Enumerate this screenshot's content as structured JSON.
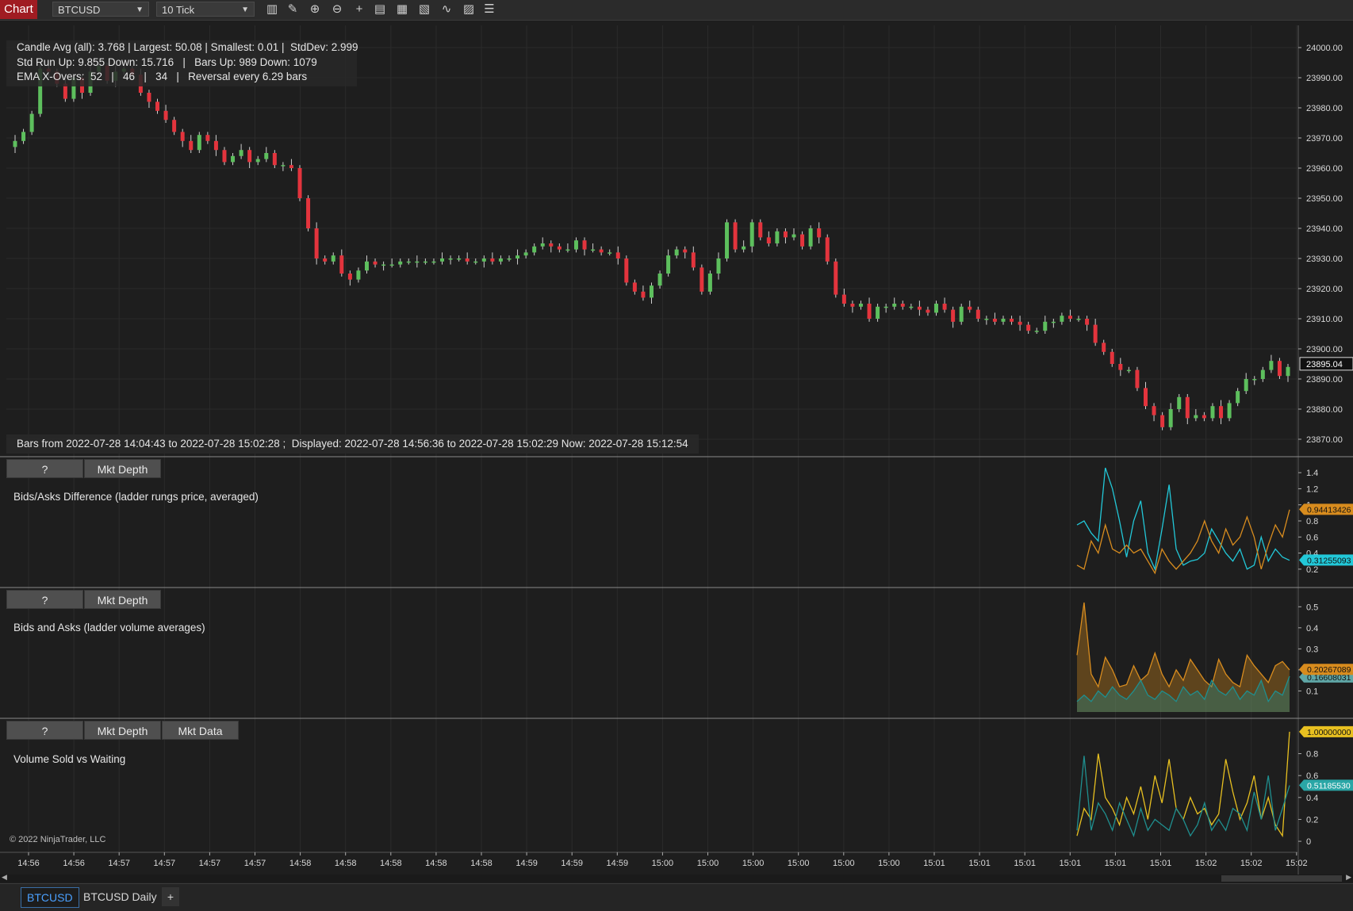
{
  "toolbar": {
    "chart_label": "Chart",
    "instrument": "BTCUSD",
    "interval": "10 Tick",
    "icons": [
      "bar-type-icon",
      "drawing-pencil-icon",
      "zoom-in-icon",
      "zoom-out-icon",
      "crosshair-icon",
      "data-box-icon",
      "properties-icon",
      "strategies-icon",
      "indicators-icon",
      "templates-icon",
      "object-list-icon"
    ]
  },
  "stats": {
    "line1": "Candle Avg (all): 3.768 | Largest: 50.08 | Smallest: 0.01 |  StdDev: 2.999",
    "line2": "Std Run Up: 9.855 Down: 15.716   |   Bars Up: 989 Down: 1079",
    "line3": "EMA X-Overs:  52   |   46   |   34   |   Reversal every 6.29 bars"
  },
  "bars_info": "Bars from 2022-07-28 14:04:43 to 2022-07-28 15:02:28 ;  Displayed: 2022-07-28 14:56:36 to 2022-07-28 15:02:29 Now: 2022-07-28 15:12:54",
  "price_axis": {
    "ticks": [
      "24000.00",
      "23990.00",
      "23980.00",
      "23970.00",
      "23960.00",
      "23950.00",
      "23940.00",
      "23930.00",
      "23920.00",
      "23910.00",
      "23900.00",
      "23890.00",
      "23880.00",
      "23870.00"
    ],
    "last_price": "23895.04"
  },
  "panel1": {
    "buttons": [
      "?",
      "Mkt Depth"
    ],
    "title": "Bids/Asks Difference (ladder rungs price, averaged)",
    "ticks": [
      "1.4",
      "1.2",
      "1",
      "0.8",
      "0.6",
      "0.4",
      "0.2"
    ],
    "markers": [
      "0.94413426",
      "0.31255093"
    ]
  },
  "panel2": {
    "buttons": [
      "?",
      "Mkt Depth"
    ],
    "title": "Bids and Asks (ladder volume averages)",
    "ticks": [
      "0.5",
      "0.4",
      "0.3",
      "0.2",
      "0.1"
    ],
    "markers": [
      "0.20267089",
      "0.16608031"
    ]
  },
  "panel3": {
    "buttons": [
      "?",
      "Mkt Depth",
      "Mkt Data"
    ],
    "title": "Volume Sold vs Waiting",
    "ticks": [
      "0.8",
      "0.6",
      "0.4",
      "0.2",
      "0"
    ],
    "markers": [
      "1.00000000",
      "0.51185530"
    ]
  },
  "copyright": "© 2022 NinjaTrader, LLC",
  "time_axis": [
    "14:56",
    "14:56",
    "14:57",
    "14:57",
    "14:57",
    "14:57",
    "14:58",
    "14:58",
    "14:58",
    "14:58",
    "14:58",
    "14:59",
    "14:59",
    "14:59",
    "15:00",
    "15:00",
    "15:00",
    "15:00",
    "15:00",
    "15:00",
    "15:01",
    "15:01",
    "15:01",
    "15:01",
    "15:01",
    "15:01",
    "15:02",
    "15:02",
    "15:02"
  ],
  "tabs": [
    "BTCUSD",
    "BTCUSD Daily",
    "+"
  ],
  "colors": {
    "up": "#5dbf5d",
    "down": "#e3343d",
    "cyan": "#22c8d8",
    "orange": "#d88c1e",
    "yellow": "#e8c020",
    "teal": "#1f8f8f",
    "chart_label": "#a01c22"
  },
  "chart_data": [
    {
      "type": "candlestick",
      "title": "BTCUSD 10 Tick",
      "ylim": [
        23865,
        24005
      ],
      "closes": [
        23969,
        23972,
        23978,
        23993,
        23992,
        23988,
        23983,
        23990,
        23985,
        23992,
        23994,
        23989,
        23992,
        23993,
        23991,
        23985,
        23982,
        23979,
        23976,
        23972,
        23969,
        23966,
        23971,
        23969,
        23966,
        23962,
        23964,
        23966,
        23962,
        23963,
        23965,
        23961,
        23961,
        23960,
        23950,
        23940,
        23930,
        23929,
        23931,
        23925,
        23923,
        23926,
        23929,
        23928,
        23928,
        23928,
        23929,
        23929,
        23929,
        23929,
        23929,
        23930,
        23930,
        23930,
        23929,
        23929,
        23930,
        23929,
        23930,
        23930,
        23931,
        23932,
        23934,
        23935,
        23934,
        23933,
        23933,
        23936,
        23933,
        23933,
        23932,
        23932,
        23930,
        23922,
        23919,
        23917,
        23921,
        23925,
        23931,
        23933,
        23932,
        23927,
        23919,
        23925,
        23930,
        23942,
        23933,
        23934,
        23942,
        23937,
        23935,
        23939,
        23937,
        23938,
        23934,
        23940,
        23937,
        23929,
        23918,
        23915,
        23914,
        23915,
        23910,
        23914,
        23914,
        23915,
        23914,
        23914,
        23913,
        23912,
        23915,
        23913,
        23909,
        23914,
        23913,
        23910,
        23910,
        23909,
        23910,
        23909,
        23908,
        23906,
        23906,
        23909,
        23909,
        23911,
        23910,
        23910,
        23908,
        23902,
        23899,
        23895,
        23893,
        23893,
        23887,
        23881,
        23878,
        23874,
        23880,
        23884,
        23877,
        23878,
        23877,
        23881,
        23877,
        23882,
        23886,
        23890,
        23890,
        23893,
        23896,
        23891,
        23894
      ]
    },
    {
      "type": "line",
      "title": "Bids/Asks Difference (ladder rungs price, averaged)",
      "ylim": [
        0.1,
        1.5
      ],
      "series": [
        {
          "name": "cyan",
          "values": [
            0.75,
            0.8,
            0.65,
            0.55,
            1.46,
            1.2,
            0.8,
            0.35,
            0.8,
            1.05,
            0.4,
            0.2,
            0.7,
            1.25,
            0.45,
            0.25,
            0.3,
            0.32,
            0.4,
            0.7,
            0.55,
            0.4,
            0.3,
            0.45,
            0.2,
            0.25,
            0.6,
            0.3,
            0.45,
            0.35,
            0.31
          ]
        },
        {
          "name": "orange",
          "values": [
            0.25,
            0.2,
            0.55,
            0.4,
            0.75,
            0.45,
            0.4,
            0.5,
            0.4,
            0.45,
            0.3,
            0.15,
            0.45,
            0.3,
            0.2,
            0.3,
            0.4,
            0.55,
            0.8,
            0.55,
            0.4,
            0.7,
            0.5,
            0.6,
            0.85,
            0.6,
            0.2,
            0.5,
            0.75,
            0.6,
            0.94
          ]
        }
      ]
    },
    {
      "type": "area",
      "title": "Bids and Asks (ladder volume averages)",
      "ylim": [
        0.0,
        0.55
      ],
      "series": [
        {
          "name": "orange",
          "values": [
            0.27,
            0.52,
            0.18,
            0.12,
            0.26,
            0.2,
            0.12,
            0.13,
            0.22,
            0.15,
            0.18,
            0.28,
            0.18,
            0.12,
            0.2,
            0.15,
            0.25,
            0.2,
            0.15,
            0.12,
            0.25,
            0.18,
            0.14,
            0.12,
            0.27,
            0.22,
            0.18,
            0.14,
            0.22,
            0.24,
            0.2
          ]
        },
        {
          "name": "teal",
          "values": [
            0.05,
            0.08,
            0.05,
            0.1,
            0.07,
            0.12,
            0.08,
            0.06,
            0.1,
            0.15,
            0.08,
            0.06,
            0.1,
            0.08,
            0.05,
            0.12,
            0.08,
            0.1,
            0.06,
            0.15,
            0.1,
            0.08,
            0.12,
            0.06,
            0.1,
            0.08,
            0.15,
            0.05,
            0.1,
            0.08,
            0.17
          ]
        }
      ]
    },
    {
      "type": "line",
      "title": "Volume Sold vs Waiting",
      "ylim": [
        -0.05,
        1.05
      ],
      "series": [
        {
          "name": "yellow",
          "values": [
            0.05,
            0.3,
            0.2,
            0.8,
            0.4,
            0.3,
            0.15,
            0.4,
            0.25,
            0.5,
            0.2,
            0.6,
            0.35,
            0.75,
            0.3,
            0.2,
            0.4,
            0.25,
            0.3,
            0.15,
            0.25,
            0.75,
            0.45,
            0.2,
            0.35,
            0.6,
            0.2,
            0.4,
            0.15,
            0.05,
            1.0
          ]
        },
        {
          "name": "teal",
          "values": [
            0.1,
            0.78,
            0.1,
            0.35,
            0.25,
            0.1,
            0.35,
            0.2,
            0.05,
            0.3,
            0.1,
            0.2,
            0.15,
            0.1,
            0.3,
            0.2,
            0.05,
            0.15,
            0.35,
            0.1,
            0.2,
            0.1,
            0.3,
            0.25,
            0.1,
            0.45,
            0.2,
            0.6,
            0.1,
            0.3,
            0.51
          ]
        }
      ]
    }
  ]
}
